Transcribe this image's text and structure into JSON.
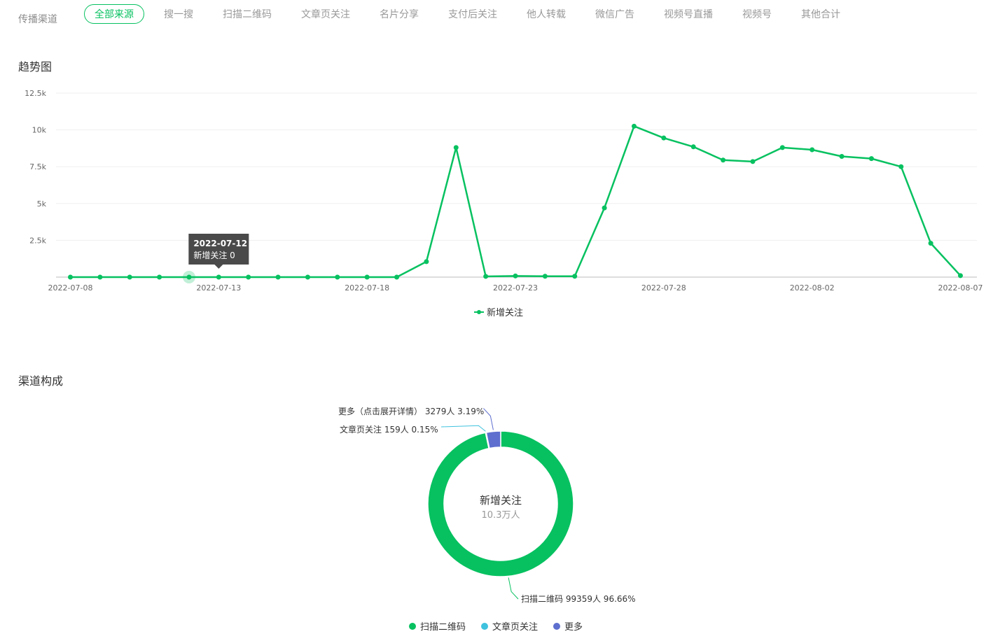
{
  "filters": {
    "label": "传播渠道",
    "tabs": [
      "全部来源",
      "搜一搜",
      "扫描二维码",
      "文章页关注",
      "名片分享",
      "支付后关注",
      "他人转载",
      "微信广告",
      "视频号直播",
      "视频号",
      "其他合计"
    ],
    "active_index": 0
  },
  "trend": {
    "title": "趋势图",
    "tooltip": {
      "date": "2022-07-12",
      "text": "新增关注 0"
    }
  },
  "composition": {
    "title": "渠道构成",
    "center_title": "新增关注",
    "center_value": "10.3万人",
    "labels": [
      "更多（点击展开详情） 3279人 3.19%",
      "文章页关注 159人 0.15%",
      "扫描二维码 99359人 96.66%"
    ],
    "legend": [
      "扫描二维码",
      "文章页关注",
      "更多"
    ]
  },
  "colors": {
    "accent": "#07c160",
    "article": "#3fc2de",
    "more": "#5e6fcf"
  },
  "chart_data": [
    {
      "type": "line",
      "title": "",
      "x": [
        "2022-07-08",
        "2022-07-09",
        "2022-07-10",
        "2022-07-11",
        "2022-07-12",
        "2022-07-13",
        "2022-07-14",
        "2022-07-15",
        "2022-07-16",
        "2022-07-17",
        "2022-07-18",
        "2022-07-19",
        "2022-07-20",
        "2022-07-21",
        "2022-07-22",
        "2022-07-23",
        "2022-07-24",
        "2022-07-25",
        "2022-07-26",
        "2022-07-27",
        "2022-07-28",
        "2022-07-29",
        "2022-07-30",
        "2022-07-31",
        "2022-08-01",
        "2022-08-02",
        "2022-08-03",
        "2022-08-04",
        "2022-08-05",
        "2022-08-06",
        "2022-08-07"
      ],
      "x_tick_labels": [
        "2022-07-08",
        "2022-07-13",
        "2022-07-18",
        "2022-07-23",
        "2022-07-28",
        "2022-08-02",
        "2022-08-07"
      ],
      "series": [
        {
          "name": "新增关注",
          "values": [
            0,
            0,
            0,
            0,
            0,
            0,
            0,
            0,
            0,
            0,
            0,
            0,
            1050,
            8800,
            50,
            80,
            60,
            60,
            4700,
            10250,
            9450,
            8850,
            7950,
            7850,
            8800,
            8650,
            8200,
            8050,
            7500,
            2300,
            100
          ]
        }
      ],
      "y_ticks": [
        "2.5k",
        "5k",
        "7.5k",
        "10k",
        "12.5k"
      ],
      "ylim": [
        0,
        12500
      ],
      "grid": true,
      "legend": "bottom-center"
    },
    {
      "type": "pie",
      "categories": [
        "扫描二维码",
        "文章页关注",
        "更多"
      ],
      "values": [
        99359,
        159,
        3279
      ],
      "percent": [
        96.66,
        0.15,
        3.19
      ],
      "legend": "bottom-center"
    }
  ]
}
